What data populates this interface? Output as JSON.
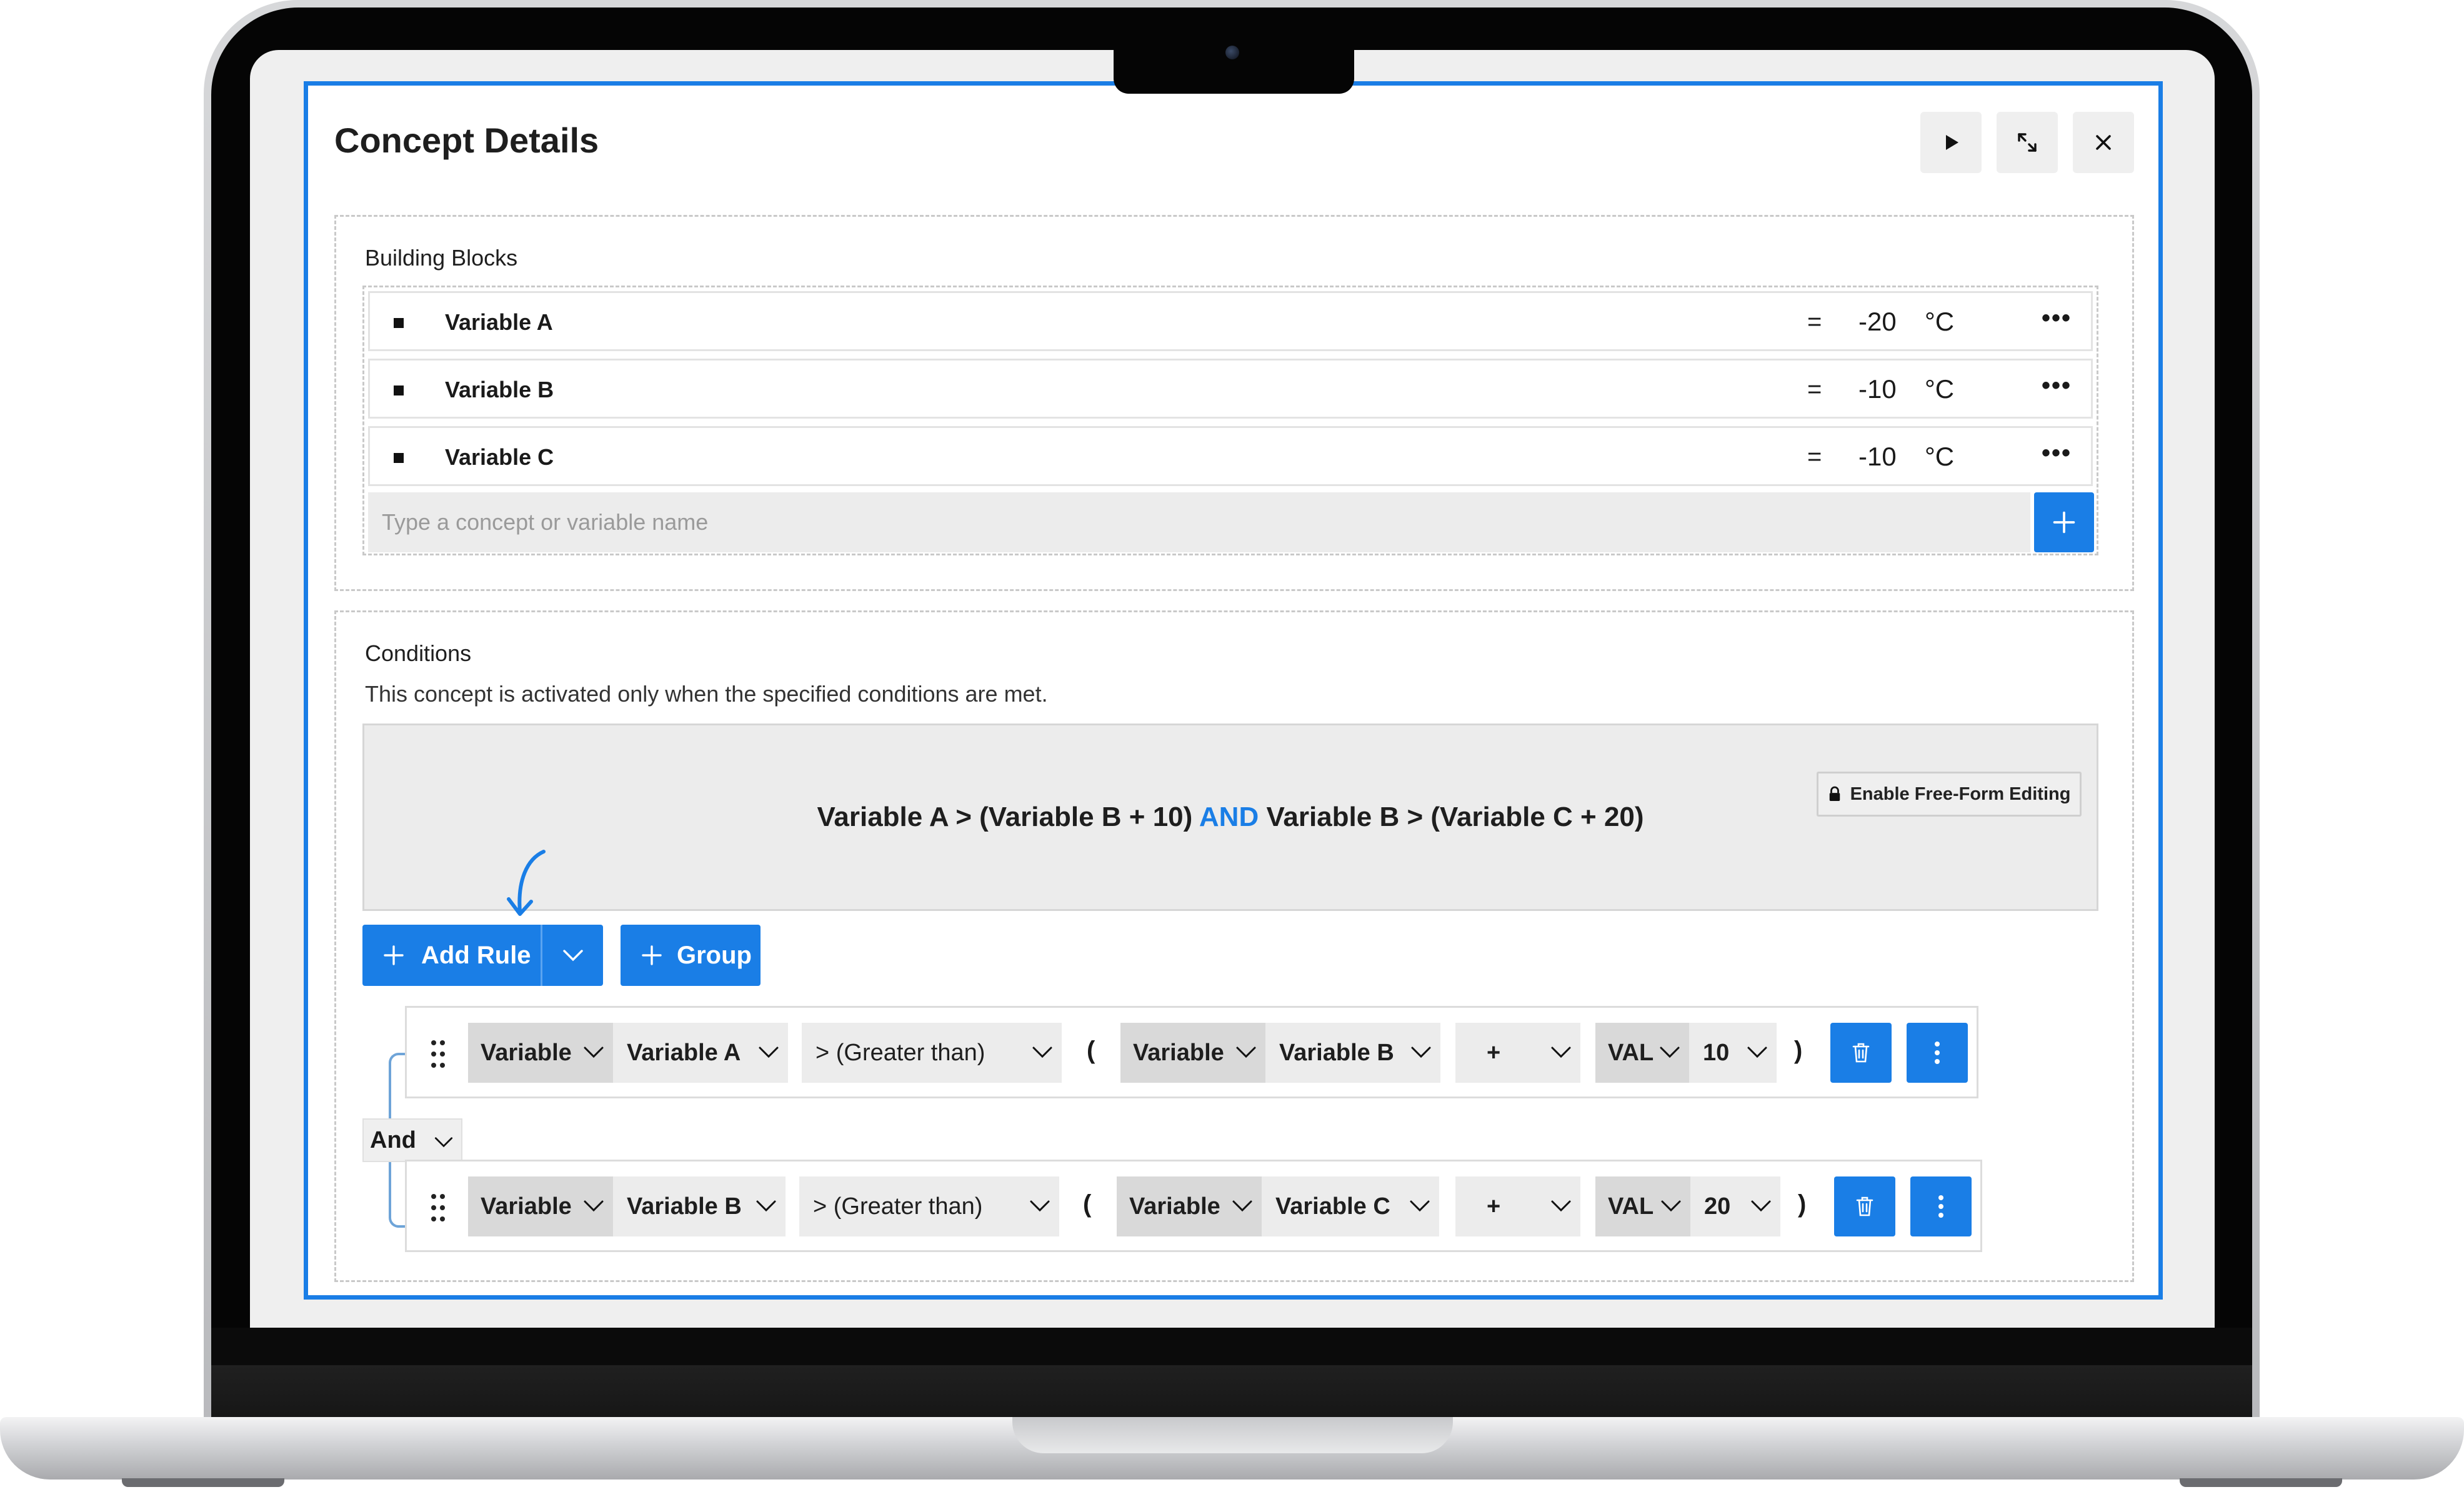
{
  "dialog": {
    "title": "Concept Details"
  },
  "building_blocks": {
    "title": "Building Blocks",
    "variables": [
      {
        "name": "Variable A",
        "operator": "=",
        "value": "-20",
        "unit": "°C"
      },
      {
        "name": "Variable B",
        "operator": "=",
        "value": "-10",
        "unit": "°C"
      },
      {
        "name": "Variable C",
        "operator": "=",
        "value": "-10",
        "unit": "°C"
      }
    ],
    "more_label": "•••",
    "input_placeholder": "Type a concept or variable name"
  },
  "conditions": {
    "title": "Conditions",
    "description": "This concept is activated only when the specified conditions are met.",
    "expression": {
      "left": "Variable A > (Variable B + 10) ",
      "keyword": "AND",
      "right": " Variable B > (Variable C + 20)"
    },
    "free_form_label": "Enable Free-Form Editing",
    "add_rule_label": "Add Rule",
    "group_label": "Group",
    "combinator": "And",
    "rules": [
      {
        "type": "Variable",
        "field": "Variable A",
        "operator": "> (Greater than)",
        "open": "(",
        "type2": "Variable",
        "field2": "Variable B",
        "arith": "+",
        "val_type": "VAL",
        "val": "10",
        "close": ")"
      },
      {
        "type": "Variable",
        "field": "Variable B",
        "operator": "> (Greater than)",
        "open": "(",
        "type2": "Variable",
        "field2": "Variable C",
        "arith": "+",
        "val_type": "VAL",
        "val": "20",
        "close": ")"
      }
    ]
  },
  "colors": {
    "accent": "#1a7ee6",
    "surface": "#efefef",
    "border": "#dcdcdc"
  },
  "icons": [
    "play-icon",
    "expand-icon",
    "close-icon",
    "plus-icon",
    "lock-icon",
    "chevron-down-icon",
    "drag-handle-icon",
    "trash-icon",
    "kebab-icon",
    "arrow-hint-icon"
  ]
}
